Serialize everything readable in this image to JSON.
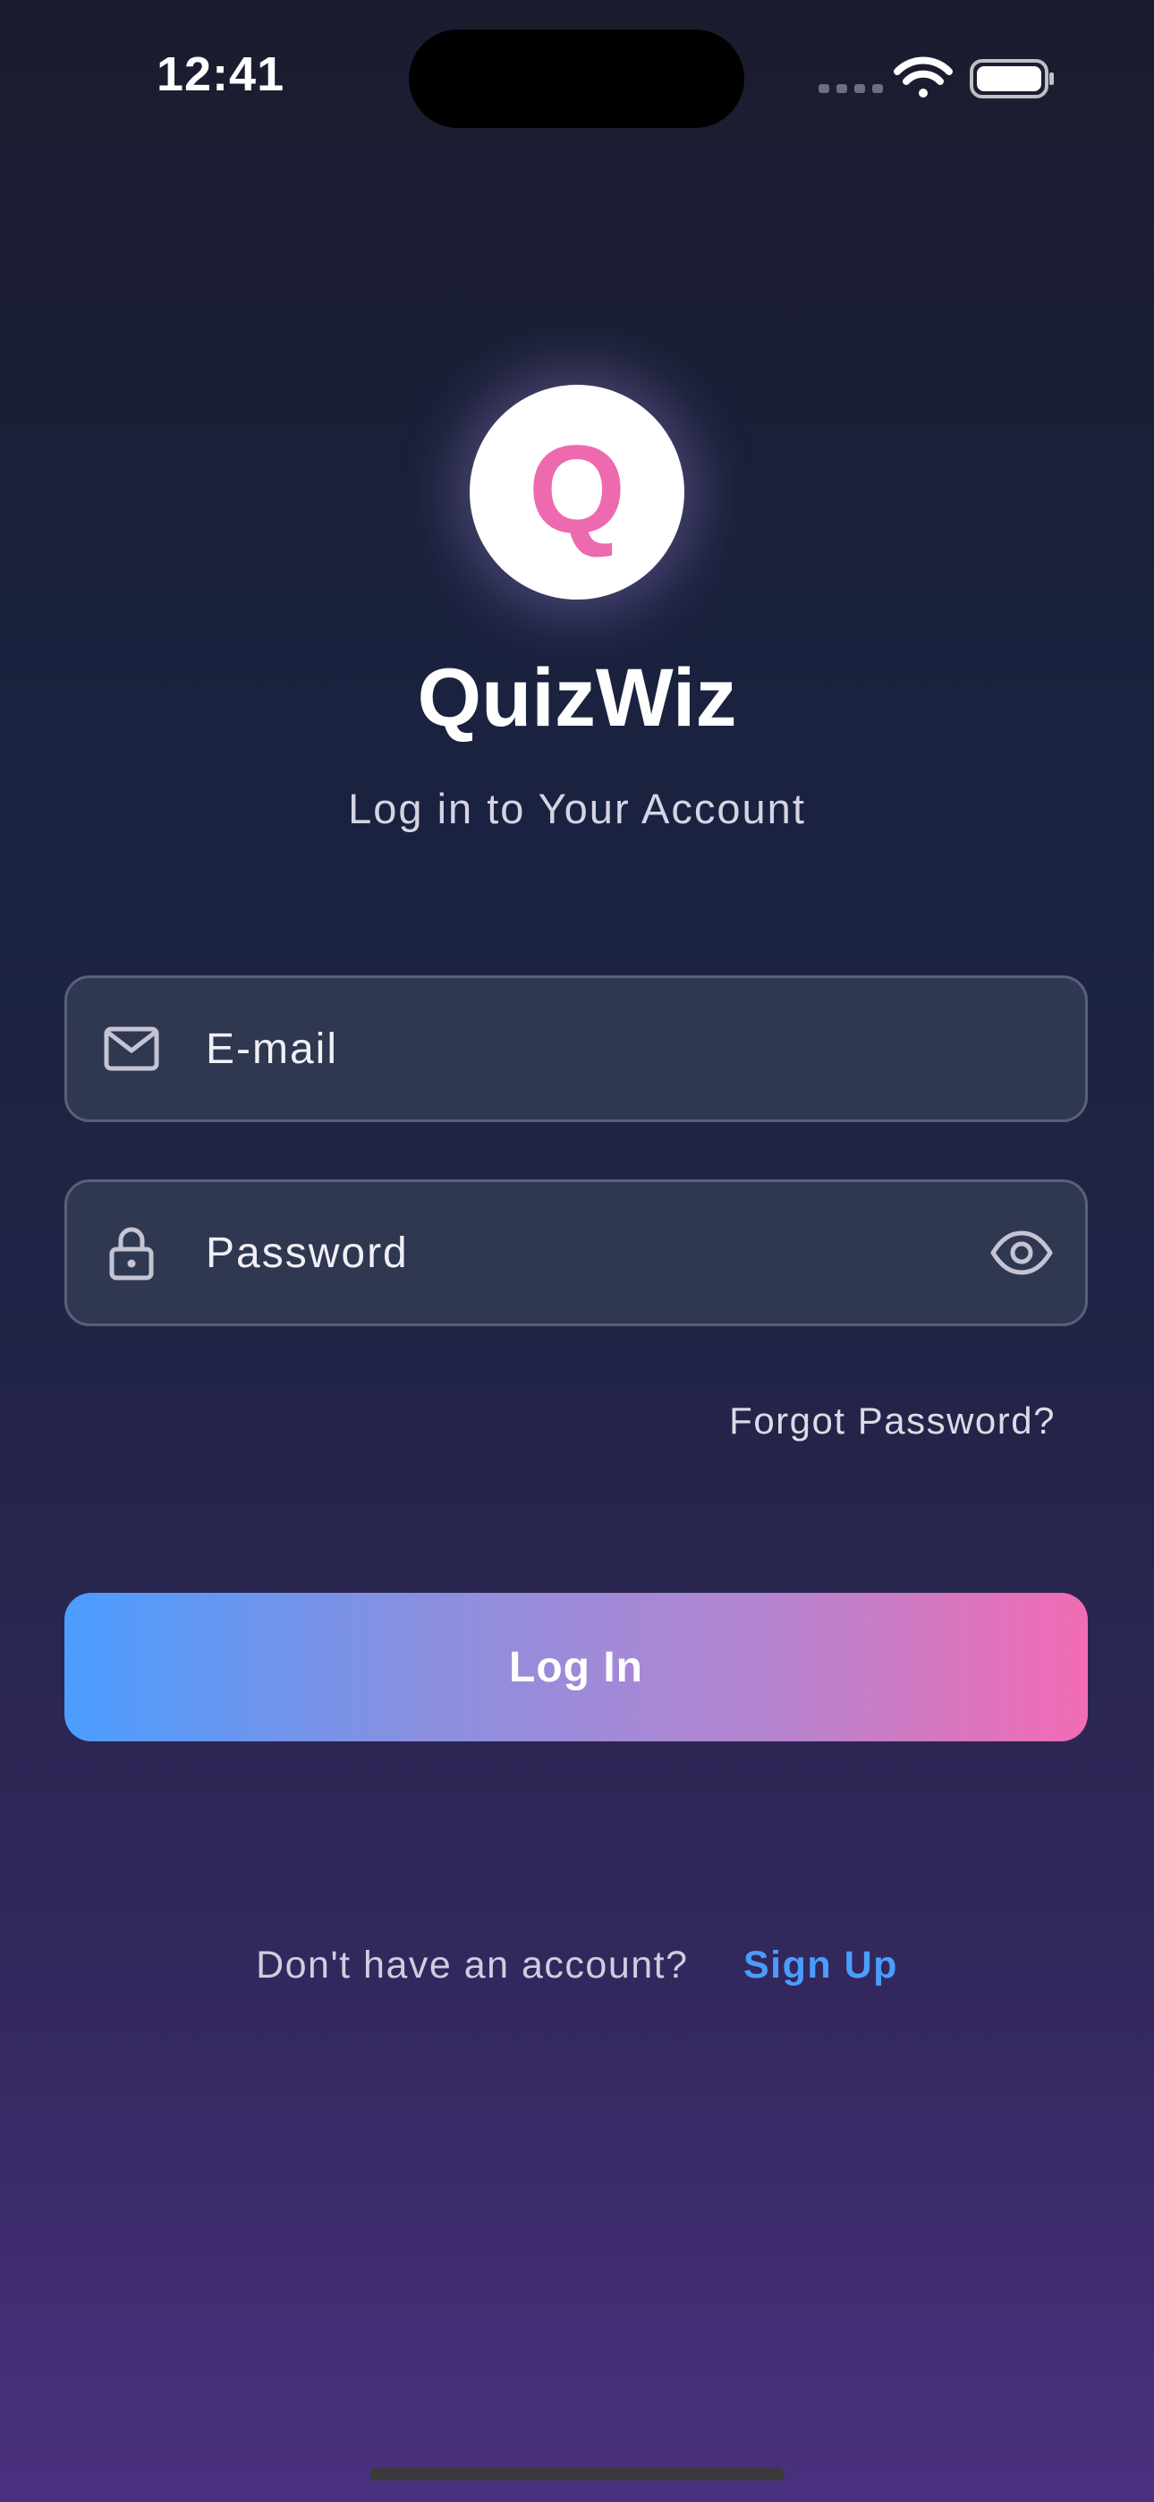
{
  "status_bar": {
    "time": "12:41"
  },
  "app": {
    "logo_letter": "Q",
    "title": "QuizWiz",
    "subtitle": "Log in to Your Account"
  },
  "form": {
    "email_placeholder": "E-mail",
    "email_value": "",
    "password_placeholder": "Password",
    "password_value": "",
    "forgot_password": "Forgot Password?",
    "login_button": "Log In"
  },
  "footer": {
    "prompt": "Don't have an account?",
    "signup_link": "Sign Up"
  },
  "icons": {
    "email": "mail-icon",
    "password": "lock-icon",
    "toggle": "eye-icon",
    "signal": "cellular-signal-icon",
    "wifi": "wifi-icon",
    "battery": "battery-icon"
  },
  "colors": {
    "accent_blue": "#4a9dff",
    "accent_pink": "#ee6aae",
    "field_bg": "#303751",
    "field_border": "#59607a"
  }
}
